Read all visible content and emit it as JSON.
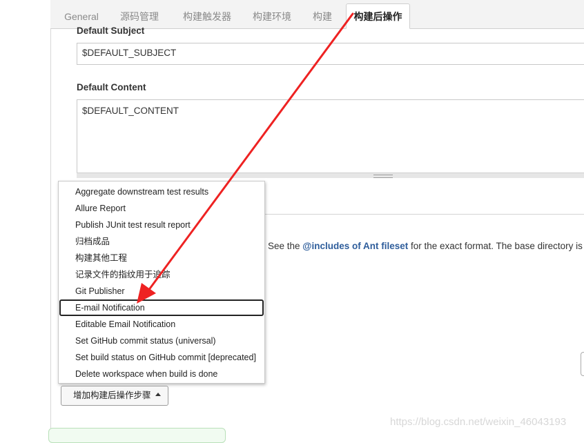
{
  "tabs": [
    {
      "label": "General",
      "active": false
    },
    {
      "label": "源码管理",
      "active": false
    },
    {
      "label": "构建触发器",
      "active": false
    },
    {
      "label": "构建环境",
      "active": false
    },
    {
      "label": "构建",
      "active": false
    },
    {
      "label": "构建后操作",
      "active": true
    }
  ],
  "form": {
    "subject_label": "Default Subject",
    "subject_value": "$DEFAULT_SUBJECT",
    "content_label": "Default Content",
    "content_value": "$DEFAULT_CONTENT"
  },
  "help": {
    "prefix": "See the ",
    "link": "@includes of Ant fileset",
    "suffix": " for the exact format. The base directory is"
  },
  "menu": {
    "items": [
      "Aggregate downstream test results",
      "Allure Report",
      "Publish JUnit test result report",
      "归档成品",
      "构建其他工程",
      "记录文件的指纹用于追踪",
      "Git Publisher",
      "E-mail Notification",
      "Editable Email Notification",
      "Set GitHub commit status (universal)",
      "Set build status on GitHub commit [deprecated]",
      "Delete workspace when build is done"
    ],
    "highlighted": "E-mail Notification"
  },
  "add_step_button": "增加构建后操作步骤",
  "watermark": "https://blog.csdn.net/weixin_46043193",
  "colors": {
    "arrow": "#ee2222",
    "link": "#2e5d9b"
  },
  "icons": {
    "caret": "caret-up-icon",
    "annotation": "red-arrow-annotation"
  }
}
